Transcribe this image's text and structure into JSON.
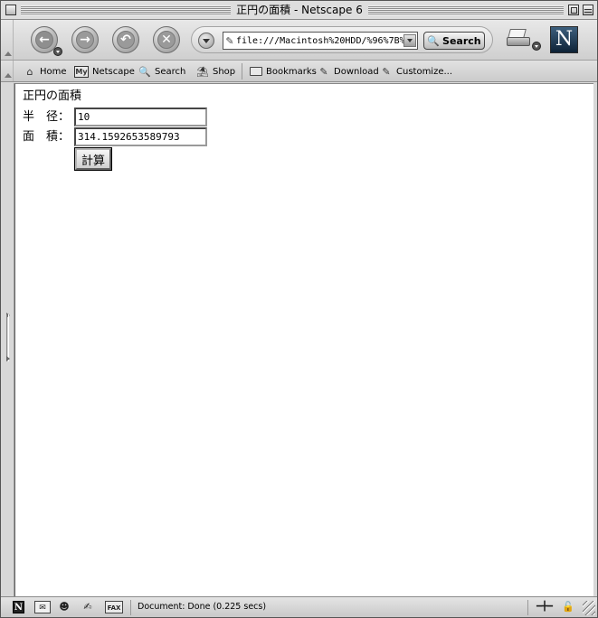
{
  "window": {
    "title": "正円の面積 - Netscape 6"
  },
  "navigation": {
    "url": "file:///Macintosh%20HDD/%96%7B%",
    "search_label": "Search",
    "logo_letter": "N"
  },
  "personal_toolbar": {
    "items": [
      {
        "label": "Home"
      },
      {
        "label": "Netscape",
        "icon_text": "My"
      },
      {
        "label": "Search"
      },
      {
        "label": "Shop"
      },
      {
        "label": "Bookmarks"
      },
      {
        "label": "Download"
      },
      {
        "label": "Customize..."
      }
    ]
  },
  "page": {
    "heading": "正円の面積",
    "radius_label": "半　径：",
    "radius_value": "10",
    "area_label": "面　積：",
    "area_value": "314.1592653589793",
    "calc_button": "計算"
  },
  "status": {
    "text": "Document: Done (0.225 secs)",
    "address_book_text": "FAX"
  }
}
